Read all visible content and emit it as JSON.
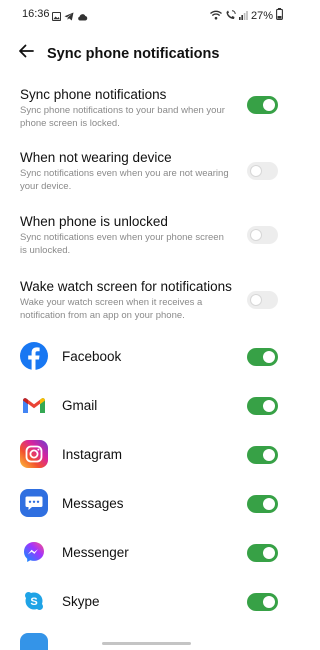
{
  "status_bar": {
    "time": "16:36",
    "battery": "27%",
    "left_icons": [
      "gallery-icon",
      "telegram-icon",
      "cloud-icon"
    ],
    "right_icons": [
      "wifi-icon",
      "wifi-calling-icon",
      "signal-icon"
    ]
  },
  "header": {
    "title": "Sync phone notifications",
    "back_icon": "back-arrow-icon"
  },
  "settings": [
    {
      "title": "Sync phone notifications",
      "description": "Sync phone notifications to your band when your phone screen is locked.",
      "enabled": true
    },
    {
      "title": "When not wearing device",
      "description": "Sync notifications even when you are not wearing your device.",
      "enabled": false
    },
    {
      "title": "When phone is unlocked",
      "description": "Sync notifications even when your phone screen is unlocked.",
      "enabled": false
    },
    {
      "title": "Wake watch screen for notifications",
      "description": "Wake your watch screen when it receives a notification from an app on your phone.",
      "enabled": false
    }
  ],
  "apps": [
    {
      "name": "Facebook",
      "icon": "facebook-icon",
      "enabled": true,
      "color": "#1877f2"
    },
    {
      "name": "Gmail",
      "icon": "gmail-icon",
      "enabled": true,
      "color": "#ea4335"
    },
    {
      "name": "Instagram",
      "icon": "instagram-icon",
      "enabled": true,
      "color": "#d6249f"
    },
    {
      "name": "Messages",
      "icon": "messages-icon",
      "enabled": true,
      "color": "#2f6fe0"
    },
    {
      "name": "Messenger",
      "icon": "messenger-icon",
      "enabled": true,
      "color": "#8a3ffc"
    },
    {
      "name": "Skype",
      "icon": "skype-icon",
      "enabled": true,
      "color": "#1fa3e6"
    }
  ],
  "colors": {
    "toggle_on": "#37a146",
    "toggle_off": "#ededed",
    "description_text": "#8a8a8a"
  }
}
